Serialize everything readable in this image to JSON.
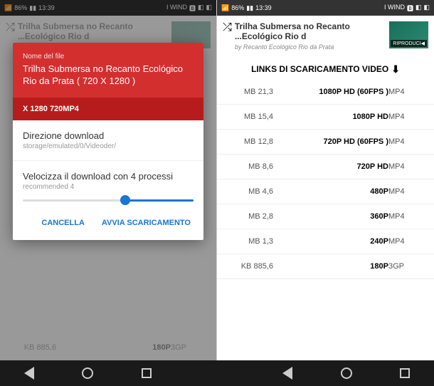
{
  "statusbar": {
    "time": "13:39",
    "carrier": "I WIND",
    "battery": "86%"
  },
  "video": {
    "title": "Trilha Submersa no Recanto Ecológico Rio d...",
    "author": "by Recanto Ecológico Rio da Prata",
    "play_label": "RIPRODUCI"
  },
  "section": {
    "links_title": "LINKS DI SCARICAMENTO VIDEO"
  },
  "rows": [
    {
      "res": "1080P HD (60FPS )",
      "fmt": "MP4",
      "size": "21,3 MB"
    },
    {
      "res": "1080P HD",
      "fmt": "MP4",
      "size": "15,4 MB"
    },
    {
      "res": "720P HD (60FPS )",
      "fmt": "MP4",
      "size": "12,8 MB"
    },
    {
      "res": "720P HD",
      "fmt": "MP4",
      "size": "8,6 MB"
    },
    {
      "res": "480P",
      "fmt": "MP4",
      "size": "4,6 MB"
    },
    {
      "res": "360P",
      "fmt": "MP4",
      "size": "2,8 MB"
    },
    {
      "res": "240P",
      "fmt": "MP4",
      "size": "1,3 MB"
    },
    {
      "res": "180P",
      "fmt": "3GP",
      "size": "885,6 KB"
    }
  ],
  "left_rows": [
    {
      "res": "180P",
      "fmt": "3GP",
      "size": "885,6 KB"
    }
  ],
  "dialog": {
    "file_label": "Nome del file",
    "filename": "Trilha Submersa no Recanto Ecológico Rio da Prata ( 720 X 1280 )",
    "format": "MP4",
    "resolution": "720 X 1280",
    "dir_label": "Direzione download",
    "dir_path": "/storage/emulated/0/Videoder",
    "speed_label": "Velocizza il download con 4 processi",
    "speed_sub": "4 recommended",
    "cancel": "CANCELLA",
    "confirm": "AVVIA SCARICAMENTO"
  }
}
